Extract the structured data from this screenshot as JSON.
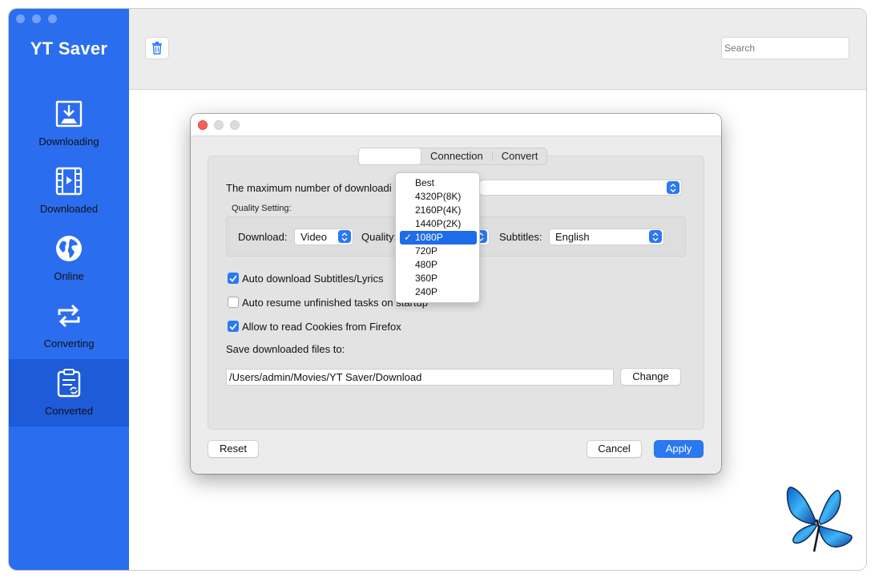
{
  "app": {
    "title": "YT Saver"
  },
  "sidebar": {
    "items": [
      {
        "label": "Downloading",
        "icon": "download-icon"
      },
      {
        "label": "Downloaded",
        "icon": "film-icon"
      },
      {
        "label": "Online",
        "icon": "globe-icon"
      },
      {
        "label": "Converting",
        "icon": "convert-arrows-icon"
      },
      {
        "label": "Converted",
        "icon": "converted-doc-icon"
      }
    ],
    "active": "Converted"
  },
  "toolbar": {
    "search_placeholder": "Search"
  },
  "dialog": {
    "tabs": [
      "",
      "Connection",
      "Convert"
    ],
    "max_downloads_label": "The maximum number of downloadi",
    "quality_setting_label": "Quality Setting:",
    "download_label": "Download:",
    "download_value": "Video",
    "quality_label": "Quality:",
    "subtitles_label": "Subtitles:",
    "subtitles_value": "English",
    "options": [
      {
        "label": "Auto download Subtitles/Lyrics",
        "checked": true
      },
      {
        "label": "Auto resume unfinished tasks on startup",
        "checked": false
      },
      {
        "label": "Allow to read Cookies from Firefox",
        "checked": true
      }
    ],
    "save_label": "Save downloaded files to:",
    "save_path": "/Users/admin/Movies/YT Saver/Download",
    "change_button": "Change",
    "reset_button": "Reset",
    "cancel_button": "Cancel",
    "apply_button": "Apply"
  },
  "quality_menu": {
    "items": [
      "Best",
      "4320P(8K)",
      "2160P(4K)",
      "1440P(2K)",
      "1080P",
      "720P",
      "480P",
      "360P",
      "240P"
    ],
    "selected": "1080P",
    "check_mark": "✓"
  },
  "colors": {
    "sidebar": "#2b6def",
    "sidebar_active": "#1d5bd8",
    "accent": "#2a78f4"
  }
}
